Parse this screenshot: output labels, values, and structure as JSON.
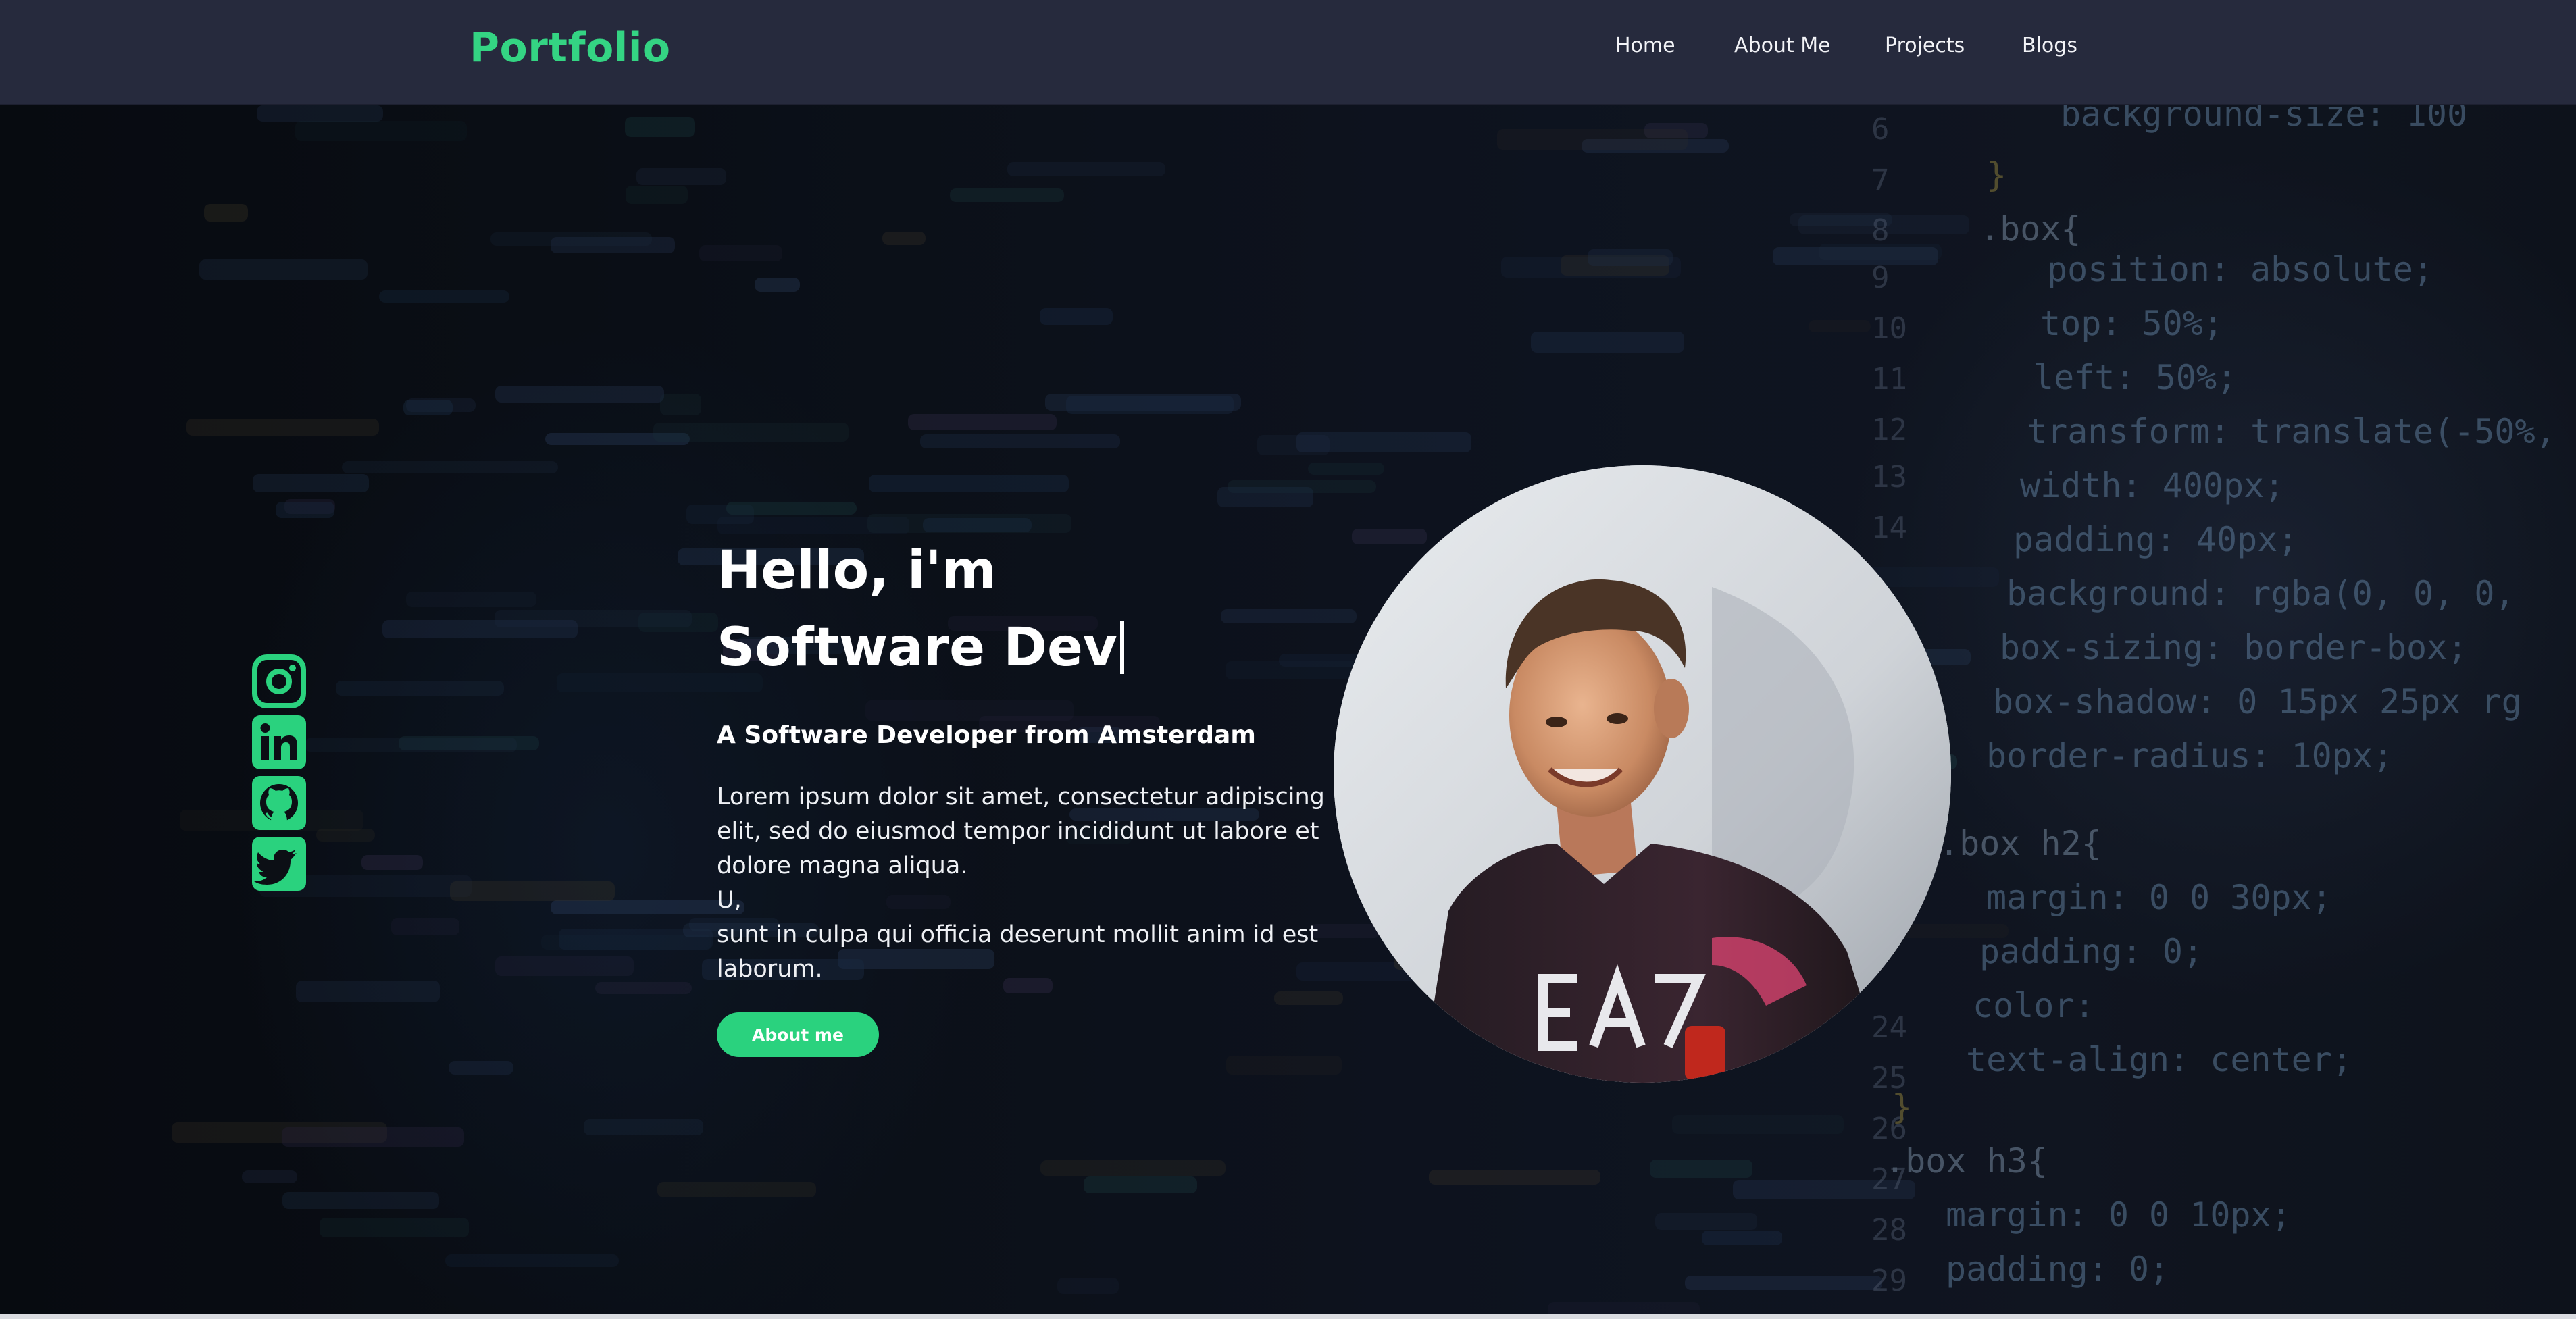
{
  "nav": {
    "brand": "Portfolio",
    "links": [
      {
        "label": "Home"
      },
      {
        "label": "About Me"
      },
      {
        "label": "Projects"
      },
      {
        "label": "Blogs"
      }
    ]
  },
  "hero": {
    "greeting": "Hello, i'm",
    "role": "Software Dev",
    "tagline": "A Software Developer from Amsterdam",
    "description": [
      "Lorem ipsum dolor sit amet, consectetur adipiscing elit, sed do eiusmod tempor incididunt ut labore et dolore magna aliqua.",
      "U,",
      "sunt in culpa qui officia deserunt mollit anim id est laborum."
    ],
    "cta_label": "About me"
  },
  "socials": [
    {
      "icon": "instagram-icon"
    },
    {
      "icon": "linkedin-icon"
    },
    {
      "icon": "github-icon"
    },
    {
      "icon": "twitter-icon"
    }
  ],
  "background_code": {
    "line_numbers": [
      "6",
      "7",
      "8",
      "9",
      "10",
      "11",
      "12",
      "13",
      "14",
      "24",
      "25",
      "26",
      "27",
      "28",
      "29"
    ],
    "lines": [
      "background-size: 100",
      "}",
      ".box{",
      "position: absolute;",
      "top: 50%;",
      "left: 50%;",
      "transform: translate(-50%,",
      "width: 400px;",
      "padding: 40px;",
      "background: rgba(0, 0, 0,",
      "box-sizing: border-box;",
      "box-shadow: 0 15px 25px rg",
      "border-radius: 10px;",
      ".box h2{",
      "margin: 0 0 30px;",
      "padding: 0;",
      "color:",
      "text-align: center;",
      "}",
      ".box h3{",
      "margin: 0 0 10px;",
      "padding: 0;"
    ]
  },
  "colors": {
    "accent": "#2ad27e",
    "navbar": "#262a3d",
    "background": "#0c0f15"
  }
}
